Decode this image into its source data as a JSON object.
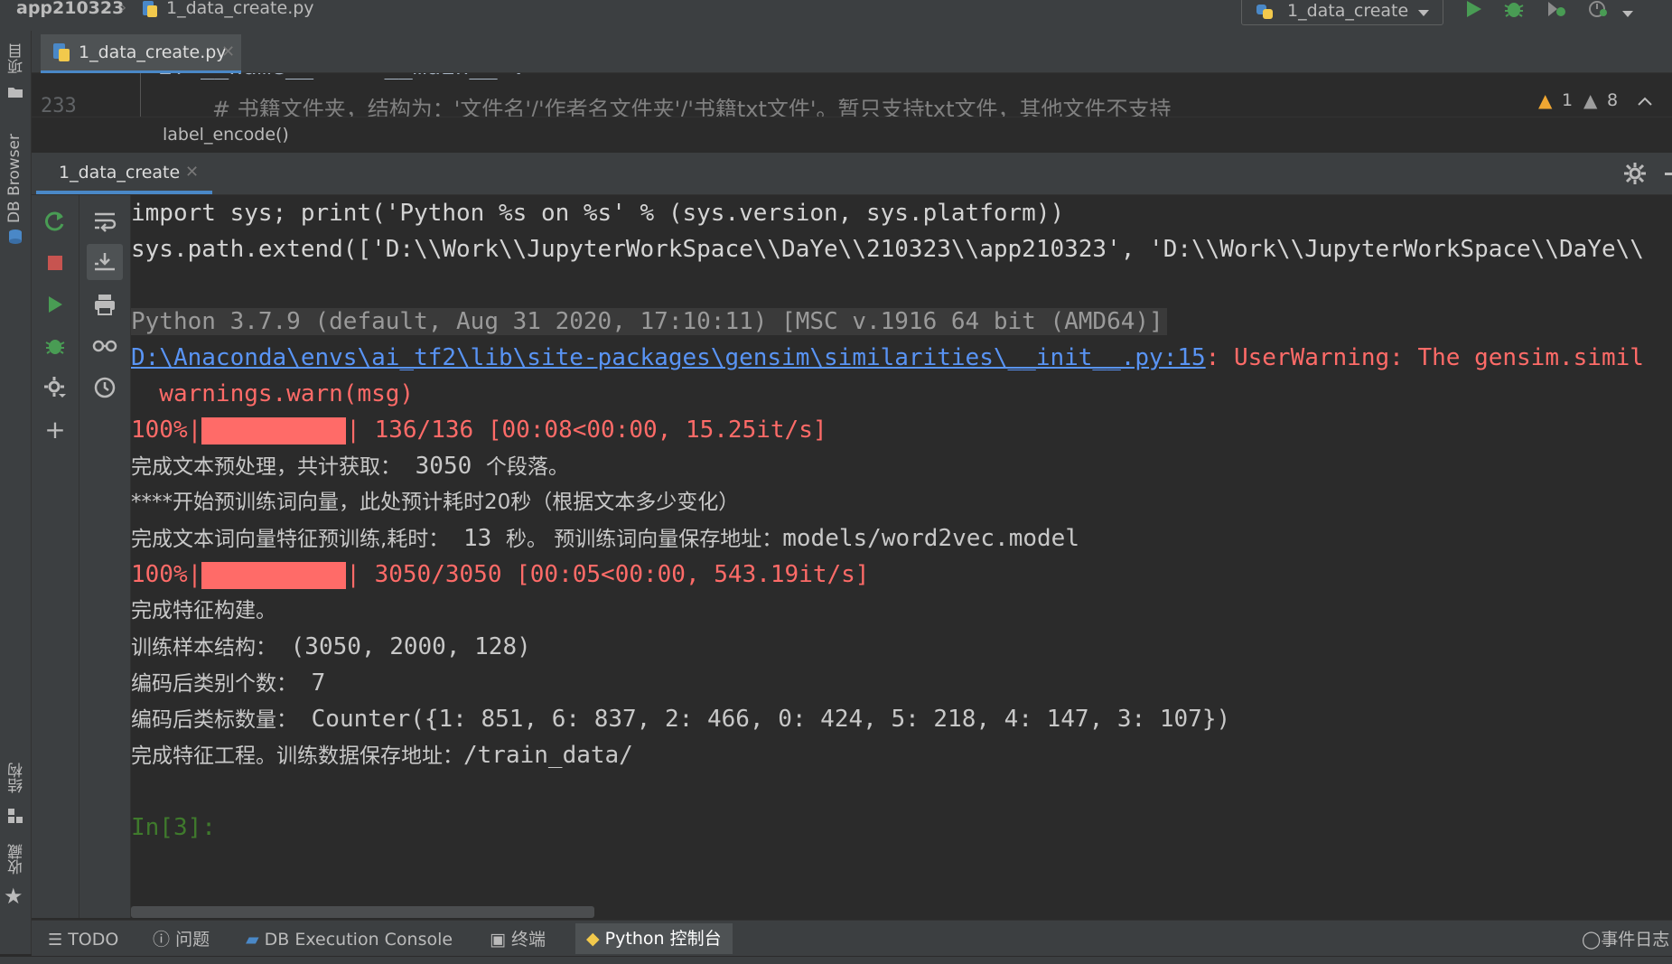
{
  "window": {
    "project_name": "app210323",
    "file_crumb": "1_data_create.py",
    "run_config": "1_data_create"
  },
  "left_strip": {
    "project": "项目",
    "db_browser": "DB Browser",
    "structure": "结构",
    "favorites": "收藏"
  },
  "editor": {
    "tab_label": "1_data_create.py",
    "line_top_partial": "if __name__ == '__main__':",
    "line_number": "233",
    "line_code": "# 书籍文件夹，结构为：'文件名'/'作者名文件夹'/'书籍txt文件'。暂只支持txt文件，其他文件不支持",
    "warn_count": "1",
    "weak_warn_count": "8",
    "breadcrumb": "label_encode()"
  },
  "console": {
    "tab_label": "1_data_create",
    "lines": {
      "cmd1": "import sys; print('Python %s on %s' % (sys.version, sys.platform))",
      "cmd2": "sys.path.extend(['D:\\\\Work\\\\JupyterWorkSpace\\\\DaYe\\\\210323\\\\app210323', 'D:\\\\Work\\\\JupyterWorkSpace\\\\DaYe\\\\",
      "pyver": "Python 3.7.9 (default, Aug 31 2020, 17:10:11) [MSC v.1916 64 bit (AMD64)]",
      "warn_link": "D:\\Anaconda\\envs\\ai_tf2\\lib\\site-packages\\gensim\\similarities\\__init__.py:15",
      "warn_text": ": UserWarning: The gensim.simil",
      "warn_call": "  warnings.warn(msg)",
      "prog1_pct": "100%|",
      "prog1_rest": "| 136/136 [00:08<00:00, 15.25it/s]",
      "zh1": "完成文本预处理，共计获取：",
      "zh1_num": " 3050 ",
      "zh1_tail": "个段落。",
      "zh2": "****开始预训练词向量，此处预计耗时20秒（根据文本多少变化）",
      "zh3_a": "完成文本词向量特征预训练,耗时：",
      "zh3_num": " 13 ",
      "zh3_b": "秒。 预训练词向量保存地址：",
      "zh3_path": "models/word2vec.model",
      "prog2_pct": "100%|",
      "prog2_rest": "| 3050/3050 [00:05<00:00, 543.19it/s]",
      "zh4": "完成特征构建。",
      "zh5_a": "训练样本结构：",
      "zh5_b": " (3050, 2000, 128)",
      "zh6_a": "编码后类别个数：",
      "zh6_b": " 7",
      "zh7_a": "编码后类标数量：",
      "zh7_b": " Counter({1: 851, 6: 837, 2: 466, 0: 424, 5: 218, 4: 147, 3: 107})",
      "zh8_a": "完成特征工程。训练数据保存地址：",
      "zh8_b": "/train_data/",
      "prompt": "In[3]:"
    },
    "progress_percent": 100
  },
  "bottom_tabs": {
    "todo": "TODO",
    "problems": "问题",
    "db_console": "DB Execution Console",
    "terminal": "终端",
    "python_console": "Python 控制台",
    "event_log": "事件日志"
  },
  "colors": {
    "accent": "#4a88c7",
    "error": "#ff6b68",
    "link": "#5994f5",
    "prompt": "#3f7a2c",
    "progress_fill": "#ff6b68"
  }
}
